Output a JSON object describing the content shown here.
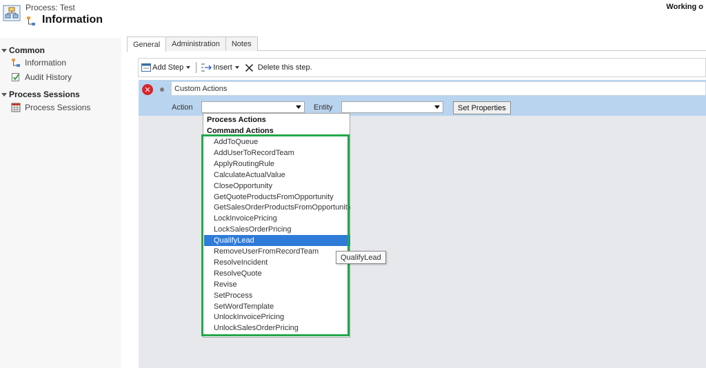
{
  "header": {
    "process_label": "Process: Test",
    "title": "Information",
    "status": "Working o"
  },
  "sidebar": {
    "sections": [
      {
        "label": "Common",
        "items": [
          {
            "label": "Information",
            "icon": "hierarchy-icon"
          },
          {
            "label": "Audit History",
            "icon": "audit-icon"
          }
        ]
      },
      {
        "label": "Process Sessions",
        "items": [
          {
            "label": "Process Sessions",
            "icon": "grid-icon"
          }
        ]
      }
    ]
  },
  "tabs": [
    {
      "label": "General",
      "active": true
    },
    {
      "label": "Administration"
    },
    {
      "label": "Notes"
    }
  ],
  "toolbar": {
    "add_step_label": "Add Step",
    "insert_label": "Insert",
    "delete_label": "Delete this step."
  },
  "step": {
    "name": "Custom Actions",
    "action_label": "Action",
    "entity_label": "Entity",
    "set_properties_label": "Set Properties",
    "action_value": "",
    "entity_value": ""
  },
  "dropdown": {
    "groups": [
      "Process Actions",
      "Command Actions"
    ],
    "options": [
      "AddToQueue",
      "AddUserToRecordTeam",
      "ApplyRoutingRule",
      "CalculateActualValue",
      "CloseOpportunity",
      "GetQuoteProductsFromOpportunity",
      "GetSalesOrderProductsFromOpportunity",
      "LockInvoicePricing",
      "LockSalesOrderPricing",
      "QualifyLead",
      "RemoveUserFromRecordTeam",
      "ResolveIncident",
      "ResolveQuote",
      "Revise",
      "SetProcess",
      "SetWordTemplate",
      "UnlockInvoicePricing",
      "UnlockSalesOrderPricing"
    ],
    "selected": "QualifyLead",
    "tooltip": "QualifyLead"
  },
  "colors": {
    "highlight": "#22a84a",
    "selection": "#2f7bd8",
    "step_header": "#b9d4ee"
  }
}
